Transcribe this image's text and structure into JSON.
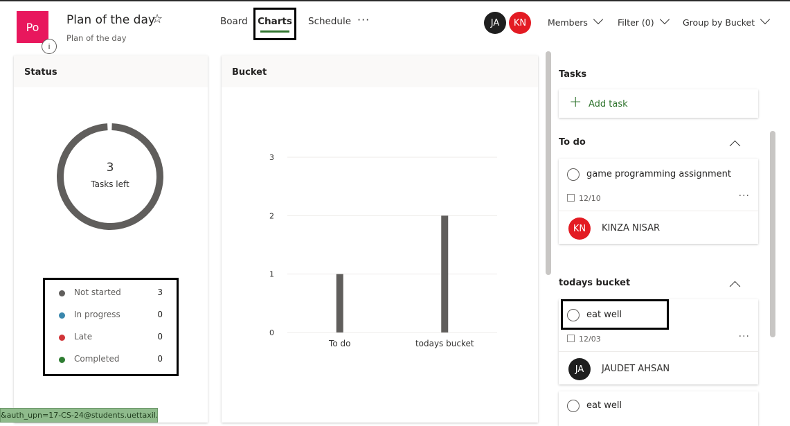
{
  "header": {
    "plan_initials": "Po",
    "plan_title": "Plan of the day",
    "plan_subtitle": "Plan of the day",
    "info_glyph": "i",
    "star_glyph": "☆",
    "tabs": [
      {
        "label": "Board"
      },
      {
        "label": "Charts",
        "active": true
      },
      {
        "label": "Schedule"
      }
    ],
    "more_glyph": "···",
    "members_avatars": [
      {
        "initials": "JA",
        "color": "#1f1f1f"
      },
      {
        "initials": "KN",
        "color": "#e31b23"
      }
    ],
    "members_label": "Members",
    "filter_label": "Filter (0)",
    "group_label": "Group by Bucket"
  },
  "status": {
    "title": "Status",
    "tasks_left_count": "3",
    "tasks_left_label": "Tasks left",
    "legend": [
      {
        "label": "Not started",
        "count": "3",
        "color": "#605e5c"
      },
      {
        "label": "In progress",
        "count": "0",
        "color": "#3a87ad"
      },
      {
        "label": "Late",
        "count": "0",
        "color": "#d13438"
      },
      {
        "label": "Completed",
        "count": "0",
        "color": "#2e7d32"
      }
    ]
  },
  "chart_data": {
    "type": "bar",
    "title": "Bucket",
    "categories": [
      "To do",
      "todays bucket"
    ],
    "values": [
      1,
      2
    ],
    "ylim": [
      0,
      3
    ],
    "yticks": [
      "0",
      "1",
      "2",
      "3"
    ],
    "grid": true,
    "bar_color": "#605e5c"
  },
  "tasks": {
    "title": "Tasks",
    "add_task_label": "Add task",
    "buckets": [
      {
        "name": "To do",
        "items": [
          {
            "title": "game programming assignment",
            "date": "12/10",
            "assignee_initials": "KN",
            "assignee_name": "KINZA NISAR",
            "assignee_color": "#e31b23"
          }
        ]
      },
      {
        "name": "todays bucket",
        "items": [
          {
            "title": "eat well",
            "date": "12/03",
            "assignee_initials": "JA",
            "assignee_name": "JAUDET AHSAN",
            "assignee_color": "#1f1f1f"
          },
          {
            "title": "eat well"
          }
        ]
      }
    ],
    "more_glyph": "···"
  },
  "status_bar": {
    "text": "&auth_upn=17-CS-24@students.uettaxil..."
  },
  "colors": {
    "accent": "#31752f",
    "plan_tile": "#e8175d"
  }
}
